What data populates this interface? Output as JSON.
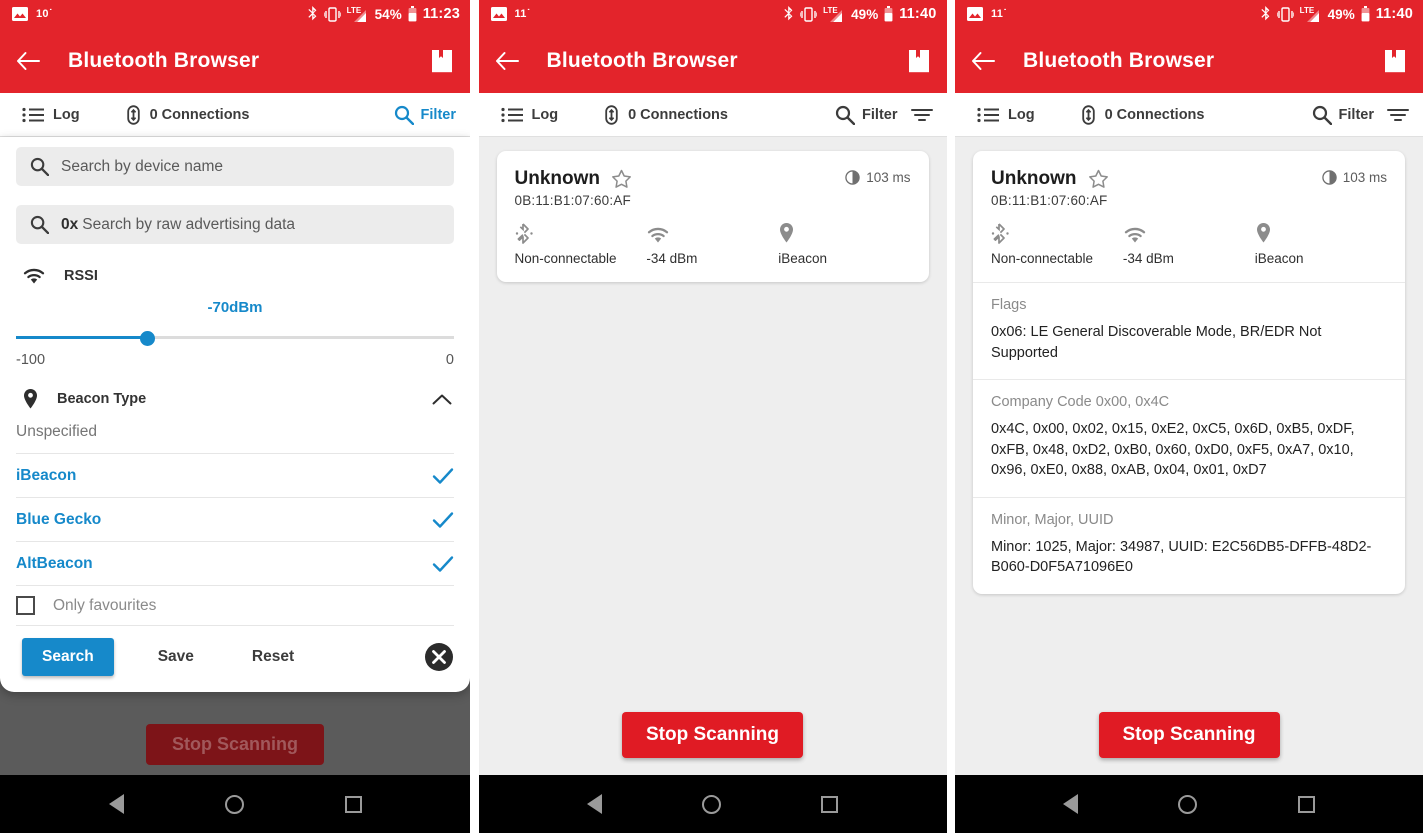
{
  "colors": {
    "brand_red": "#E3242B",
    "accent_blue": "#1689CA",
    "stop_red": "#E01B24"
  },
  "panels": [
    {
      "status": {
        "temp": "10˙",
        "lte": "LTE",
        "battery": "54%",
        "time": "11:23"
      },
      "appbar": {
        "title": "Bluetooth Browser",
        "back_icon": "back-arrow-icon",
        "book_icon": "bookmark-book-icon"
      },
      "tabs": [
        {
          "label": "Log",
          "icon": "list-icon",
          "active": false
        },
        {
          "label": "0 Connections",
          "icon": "bluetooth-link-icon",
          "active": false
        },
        {
          "label": "Filter",
          "icon": "search-icon",
          "active": true
        }
      ],
      "filter_sheet": {
        "name_search": {
          "placeholder": "Search by device name",
          "value": "",
          "icon": "search-icon"
        },
        "raw_search": {
          "prefix": "0x",
          "placeholder": "Search by raw advertising data",
          "value": "",
          "icon": "search-icon"
        },
        "rssi": {
          "label": "RSSI",
          "icon": "signal-wifi-icon",
          "value_label": "-70dBm",
          "min_label": "-100",
          "max_label": "0",
          "percent": 30
        },
        "beacon_type": {
          "label": "Beacon Type",
          "icon": "location-pin-icon",
          "chevron": "chevron-up-icon",
          "options": [
            {
              "label": "Unspecified",
              "selected": false
            },
            {
              "label": "iBeacon",
              "selected": true
            },
            {
              "label": "Blue Gecko",
              "selected": true
            },
            {
              "label": "AltBeacon",
              "selected": true
            }
          ]
        },
        "only_favourites": {
          "label": "Only favourites",
          "checked": false
        },
        "actions": {
          "search": "Search",
          "save": "Save",
          "reset": "Reset",
          "close_icon": "close-circle-icon"
        }
      },
      "ghost_stop_label": "Stop Scanning"
    },
    {
      "status": {
        "temp": "11˙",
        "lte": "LTE",
        "battery": "49%",
        "time": "11:40"
      },
      "appbar": {
        "title": "Bluetooth Browser",
        "back_icon": "back-arrow-icon",
        "book_icon": "bookmark-book-icon"
      },
      "tabs": [
        {
          "label": "Log",
          "icon": "list-icon",
          "active": false
        },
        {
          "label": "0 Connections",
          "icon": "bluetooth-link-icon",
          "active": false
        },
        {
          "label": "Filter",
          "icon": "search-icon",
          "active": false
        }
      ],
      "filter_active_icon": "filter-lines-icon",
      "device": {
        "name": "Unknown",
        "favourite_icon": "star-outline-icon",
        "address": "0B:11:B1:07:60:AF",
        "timing": "103 ms",
        "timing_icon": "clock-icon",
        "attributes": [
          {
            "icon": "bluetooth-disabled-icon",
            "text": "Non-connectable"
          },
          {
            "icon": "signal-wifi-icon",
            "text": "-34 dBm"
          },
          {
            "icon": "location-pin-icon",
            "text": "iBeacon"
          }
        ]
      },
      "stop_label": "Stop Scanning"
    },
    {
      "status": {
        "temp": "11˙",
        "lte": "LTE",
        "battery": "49%",
        "time": "11:40"
      },
      "appbar": {
        "title": "Bluetooth Browser",
        "back_icon": "back-arrow-icon",
        "book_icon": "bookmark-book-icon"
      },
      "tabs": [
        {
          "label": "Log",
          "icon": "list-icon",
          "active": false
        },
        {
          "label": "0 Connections",
          "icon": "bluetooth-link-icon",
          "active": false
        },
        {
          "label": "Filter",
          "icon": "search-icon",
          "active": false
        }
      ],
      "filter_active_icon": "filter-lines-icon",
      "device": {
        "name": "Unknown",
        "favourite_icon": "star-outline-icon",
        "address": "0B:11:B1:07:60:AF",
        "timing": "103 ms",
        "timing_icon": "clock-icon",
        "attributes": [
          {
            "icon": "bluetooth-disabled-icon",
            "text": "Non-connectable"
          },
          {
            "icon": "signal-wifi-icon",
            "text": "-34 dBm"
          },
          {
            "icon": "location-pin-icon",
            "text": "iBeacon"
          }
        ],
        "sections": [
          {
            "key": "Flags",
            "value": "0x06: LE General Discoverable Mode, BR/EDR Not Supported"
          },
          {
            "key": "Company Code 0x00, 0x4C",
            "value": "0x4C, 0x00, 0x02, 0x15, 0xE2, 0xC5, 0x6D, 0xB5, 0xDF, 0xFB, 0x48, 0xD2, 0xB0, 0x60, 0xD0, 0xF5, 0xA7, 0x10, 0x96, 0xE0, 0x88, 0xAB, 0x04, 0x01, 0xD7"
          },
          {
            "key": "Minor, Major, UUID",
            "value": "Minor: 1025, Major: 34987, UUID: E2C56DB5-DFFB-48D2-B060-D0F5A71096E0"
          }
        ]
      },
      "stop_label": "Stop Scanning"
    }
  ]
}
